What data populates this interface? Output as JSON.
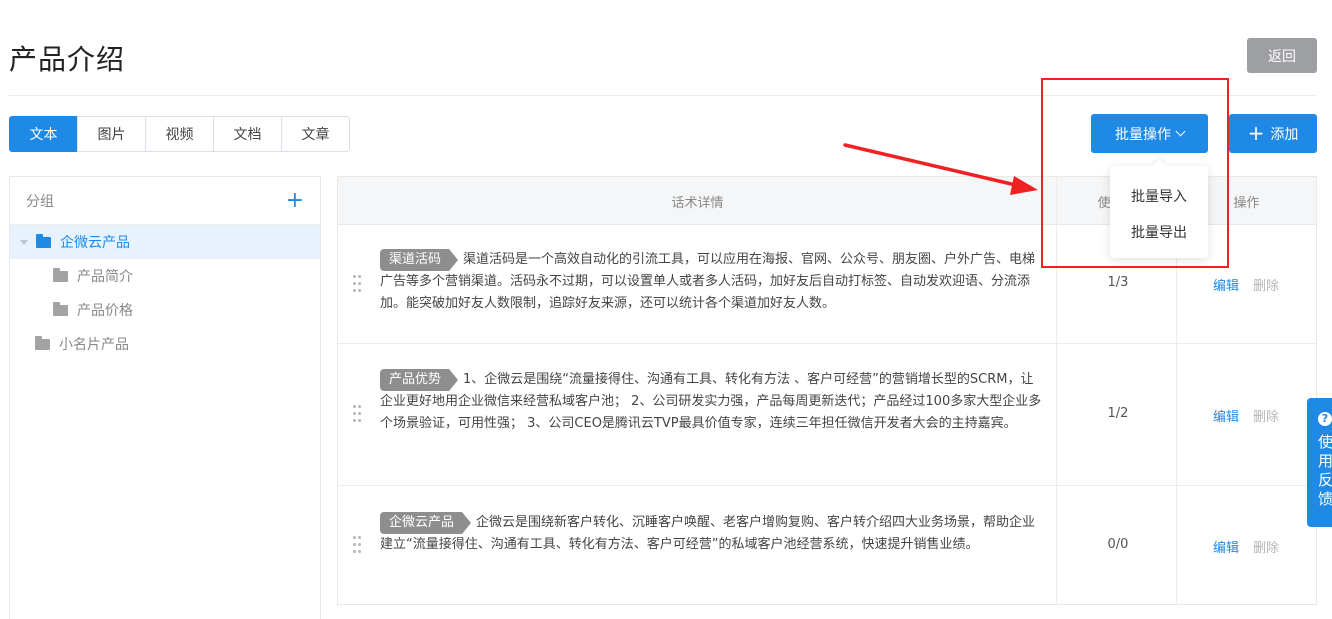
{
  "page": {
    "title": "产品介绍",
    "back_label": "返回"
  },
  "tabs": [
    "文本",
    "图片",
    "视频",
    "文档",
    "文章"
  ],
  "toolbar": {
    "batch_label": "批量操作",
    "add_label": "添加"
  },
  "dropdown": {
    "items": [
      "批量导入",
      "批量导出"
    ]
  },
  "group_panel": {
    "title": "分组",
    "tree": [
      {
        "label": "企微云产品",
        "selected": true,
        "level": 0
      },
      {
        "label": "产品简介",
        "level": 1
      },
      {
        "label": "产品价格",
        "level": 1
      },
      {
        "label": "小名片产品",
        "level": 0
      }
    ]
  },
  "table": {
    "headers": {
      "detail": "话术详情",
      "usage": "使用人",
      "actions": "操作"
    },
    "edit_label": "编辑",
    "delete_label": "删除",
    "rows": [
      {
        "tag": "渠道活码",
        "text": "渠道活码是一个高效自动化的引流工具，可以应用在海报、官网、公众号、朋友圈、户外广告、电梯广告等多个营销渠道。活码永不过期，可以设置单人或者多人活码，加好友后自动打标签、自动发欢迎语、分流添加。能突破加好友人数限制，追踪好友来源，还可以统计各个渠道加好友人数。",
        "usage": "1/3"
      },
      {
        "tag": "产品优势",
        "text": "1、企微云是围绕“流量接得住、沟通有工具、转化有方法 、客户可经营”的营销增长型的SCRM，让企业更好地用企业微信来经营私域客户池； 2、公司研发实力强，产品每周更新迭代；产品经过100多家大型企业多个场景验证，可用性强； 3、公司CEO是腾讯云TVP最具价值专家，连续三年担任微信开发者大会的主持嘉宾。",
        "usage": "1/2"
      },
      {
        "tag": "企微云产品",
        "text": "企微云是围绕新客户转化、沉睡客户唤醒、老客户增购复购、客户转介绍四大业务场景，帮助企业建立“流量接得住、沟通有工具、转化有方法、客户可经营”的私域客户池经营系统，快速提升销售业绩。",
        "usage": "0/0"
      }
    ]
  },
  "feedback": {
    "label": "使用反馈",
    "icon": "?"
  },
  "colors": {
    "primary": "#1f89e6",
    "annotation": "#ee2222",
    "tag": "#8e8e8e"
  }
}
